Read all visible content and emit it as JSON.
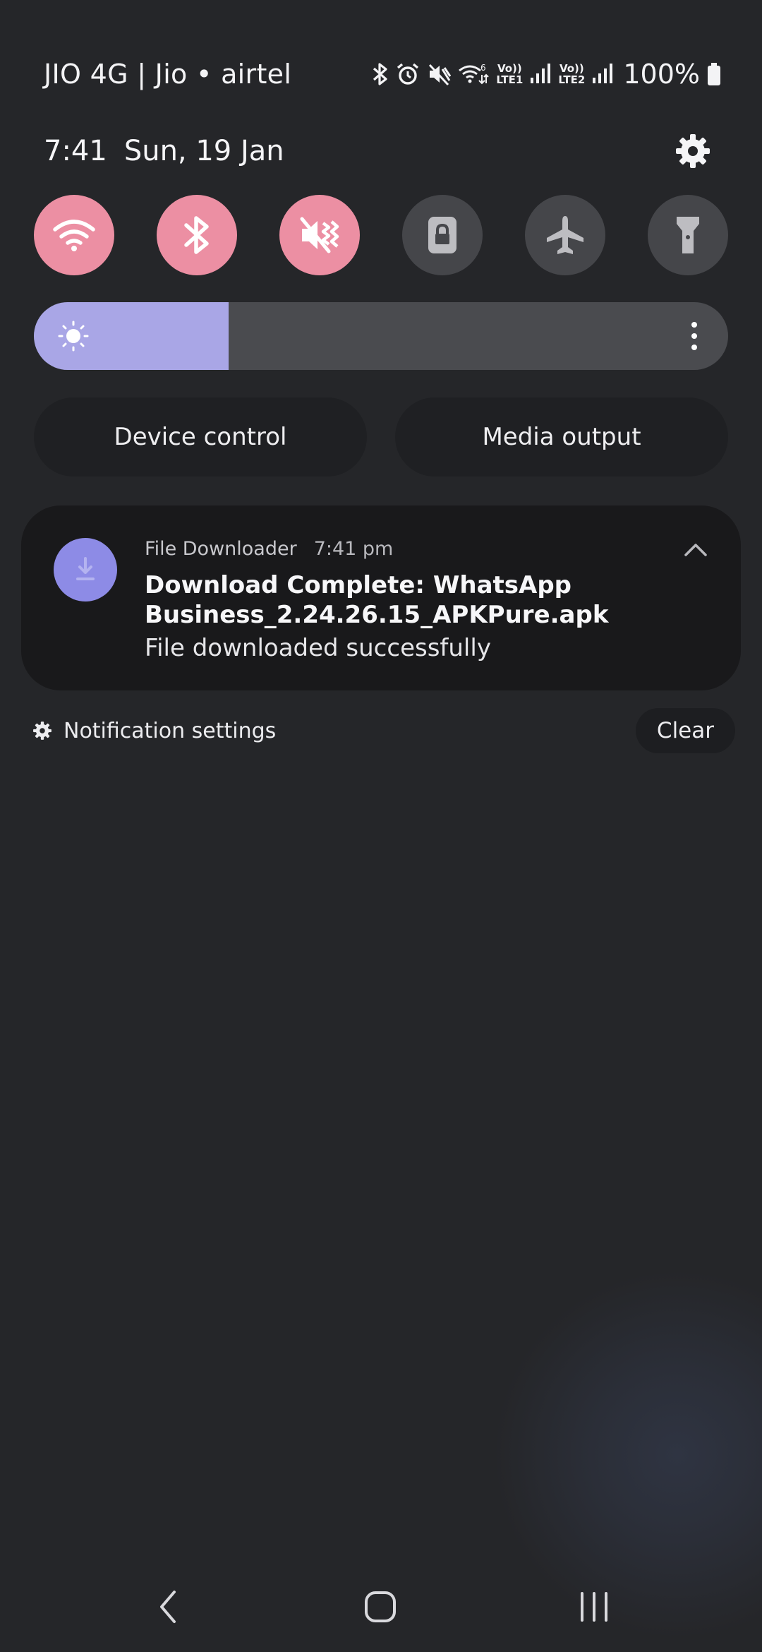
{
  "status_bar": {
    "carrier": "JIO 4G | Jio • airtel",
    "sim1_tag": "LTE1",
    "sim2_tag": "LTE2",
    "volte": "Vo))",
    "battery": "100%",
    "icons": [
      "bluetooth-icon",
      "alarm-icon",
      "mute-icon",
      "wifi-6-icon",
      "signal-icon",
      "battery-icon"
    ]
  },
  "header": {
    "time": "7:41",
    "date": "Sun, 19 Jan"
  },
  "quick_settings": {
    "tiles": [
      {
        "name": "wifi",
        "icon": "wifi-icon",
        "on": true
      },
      {
        "name": "bluetooth",
        "icon": "bluetooth-icon",
        "on": true
      },
      {
        "name": "sound",
        "icon": "vibrate-mute-icon",
        "on": true
      },
      {
        "name": "rotation-lock",
        "icon": "lock-icon",
        "on": false
      },
      {
        "name": "airplane-mode",
        "icon": "airplane-icon",
        "on": false
      },
      {
        "name": "torch",
        "icon": "flashlight-icon",
        "on": false
      }
    ],
    "brightness_level": 0.28,
    "colors": {
      "active_tile": "#ec8fa3",
      "inactive_tile": "#45464a",
      "brightness_fill": "#a9a6e6"
    }
  },
  "buttons": {
    "device_control": "Device control",
    "media_output": "Media output"
  },
  "notification": {
    "app": "File Downloader",
    "time": "7:41 pm",
    "title_line1": "Download Complete: WhatsApp",
    "title_line2": "Business_2.24.26.15_APKPure.apk",
    "body": "File downloaded successfully",
    "icon": "download-icon",
    "accent": "#8d8be6"
  },
  "footer": {
    "settings_label": "Notification settings",
    "clear_label": "Clear"
  },
  "nav": {
    "icons": [
      "back-icon",
      "home-icon",
      "recents-icon"
    ]
  }
}
